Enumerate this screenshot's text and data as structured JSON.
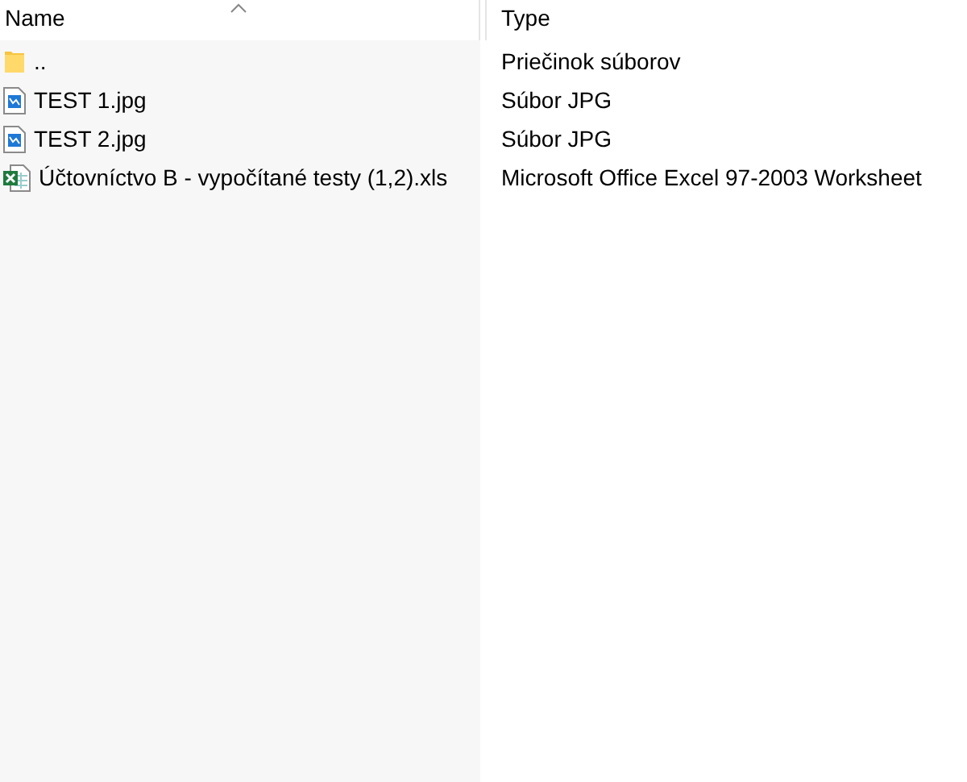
{
  "columns": [
    {
      "label": "Name",
      "sorted": true
    },
    {
      "label": "Type",
      "sorted": false
    }
  ],
  "rows": [
    {
      "kind": "folder",
      "name": "..",
      "type": "Priečinok súborov"
    },
    {
      "kind": "image",
      "name": "TEST 1.jpg",
      "type": "Súbor JPG"
    },
    {
      "kind": "image",
      "name": "TEST 2.jpg",
      "type": "Súbor JPG"
    },
    {
      "kind": "spreadsheet",
      "name": "Účtovníctvo B - vypočítané testy (1,2).xls",
      "type": "Microsoft Office Excel 97-2003 Worksheet"
    }
  ]
}
